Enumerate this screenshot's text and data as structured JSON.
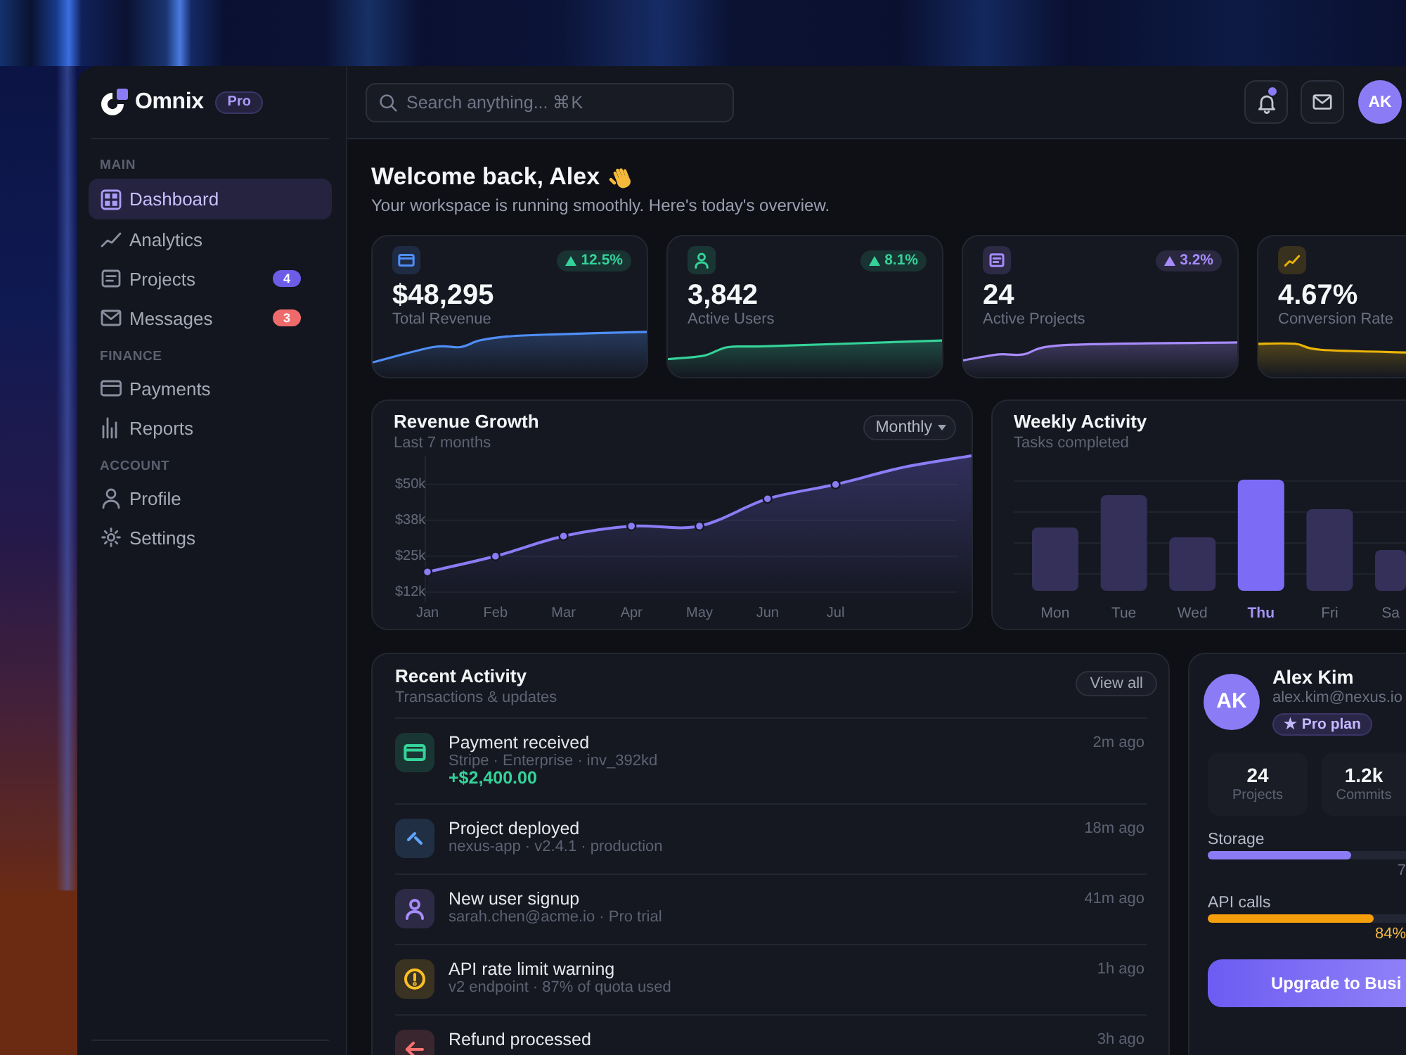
{
  "sidebar": {
    "brand": {
      "name": "Omnix",
      "badge": "Pro"
    },
    "sections": [
      {
        "title": "MAIN",
        "items": [
          {
            "label": "Dashboard",
            "selected": true
          },
          {
            "label": "Analytics",
            "selected": false
          },
          {
            "label": "Projects",
            "selected": false,
            "badge": {
              "text": "4",
              "color": "#6c5ce7"
            }
          },
          {
            "label": "Messages",
            "selected": false,
            "badge": {
              "text": "3",
              "color": "#ef6b6b"
            }
          }
        ]
      },
      {
        "title": "FINANCE",
        "items": [
          {
            "label": "Payments",
            "selected": false
          },
          {
            "label": "Reports",
            "selected": false
          }
        ]
      },
      {
        "title": "ACCOUNT",
        "items": [
          {
            "label": "Profile",
            "selected": false
          },
          {
            "label": "Settings",
            "selected": false
          }
        ]
      }
    ]
  },
  "topbar": {
    "search": {
      "placeholder": "Search anything... ⌘K"
    },
    "notifications": {
      "unread": true
    },
    "avatar": "AK"
  },
  "welcome": {
    "title": "Welcome back, Alex",
    "subtitle": "Your workspace is running smoothly. Here's today's overview."
  },
  "stats": [
    {
      "value": "$48,295",
      "label": "Total Revenue",
      "color": "#4f8ef7",
      "change": {
        "text": "12.5%",
        "color": "#34d399"
      }
    },
    {
      "value": "3,842",
      "label": "Active Users",
      "color": "#34d399",
      "change": {
        "text": "8.1%",
        "color": "#34d399"
      }
    },
    {
      "value": "24",
      "label": "Active Projects",
      "color": "#a78bfa",
      "change": {
        "text": "3.2%",
        "color": "#a78bfa"
      }
    },
    {
      "value": "4.67%",
      "label": "Conversion Rate",
      "color": "#eab308"
    }
  ],
  "revenue": {
    "title": "Revenue Growth",
    "subtitle": "Last 7 months",
    "period": "Monthly",
    "chart_data": {
      "type": "area",
      "categories": [
        "Jan",
        "Feb",
        "Mar",
        "Apr",
        "May",
        "Jun",
        "Jul",
        null,
        null
      ],
      "values": [
        19.5,
        25,
        32,
        35.5,
        35.5,
        45,
        50,
        56,
        60
      ],
      "ylim": [
        9,
        60
      ],
      "yticks": [
        {
          "value": 12.5,
          "label": "$12k"
        },
        {
          "value": 25,
          "label": "$25k"
        },
        {
          "value": 37.5,
          "label": "$38k"
        },
        {
          "value": 50,
          "label": "$50k"
        }
      ],
      "grid": true
    }
  },
  "weekly": {
    "title": "Weekly Activity",
    "subtitle": "Tasks completed",
    "days": [
      {
        "label": "Mon",
        "selected": false
      },
      {
        "label": "Tue",
        "selected": false
      },
      {
        "label": "Wed",
        "selected": false
      },
      {
        "label": "Thu",
        "selected": true
      },
      {
        "label": "Fri",
        "selected": false
      },
      {
        "label": "Sa",
        "selected": false
      }
    ]
  },
  "activity": {
    "title": "Recent Activity",
    "subtitle": "Transactions & updates",
    "action": "View all",
    "items": [
      {
        "title": "Payment received",
        "detail": "Stripe · Enterprise · inv_392kd",
        "amount": "+$2,400.00",
        "time": "2m ago",
        "color": "#34d399"
      },
      {
        "title": "Project deployed",
        "detail": "nexus-app · v2.4.1 · production",
        "time": "18m ago",
        "color": "#60a5fa"
      },
      {
        "title": "New user signup",
        "detail": "sarah.chen@acme.io · Pro trial",
        "time": "41m ago",
        "color": "#a78bfa"
      },
      {
        "title": "API rate limit warning",
        "detail": "v2 endpoint · 87% of quota used",
        "time": "1h ago",
        "color": "#fbbf24"
      },
      {
        "title": "Refund processed",
        "time": "3h ago",
        "color": "#f87171"
      }
    ]
  },
  "profile": {
    "avatar": "AK",
    "name": "Alex Kim",
    "email": "alex.kim@nexus.io",
    "plan": "★ Pro plan",
    "stats": [
      {
        "value": "24",
        "label": "Projects"
      },
      {
        "value": "1.2k",
        "label": "Commits"
      }
    ],
    "usage": [
      {
        "label": "Storage",
        "level": 0.72,
        "reading": "7",
        "color": "#8b7cf6",
        "warning": false
      },
      {
        "label": "API calls",
        "level": 0.84,
        "reading": "84%",
        "color": "#f59e0b",
        "warning": true
      }
    ],
    "upgrade": "Upgrade to Busi"
  }
}
